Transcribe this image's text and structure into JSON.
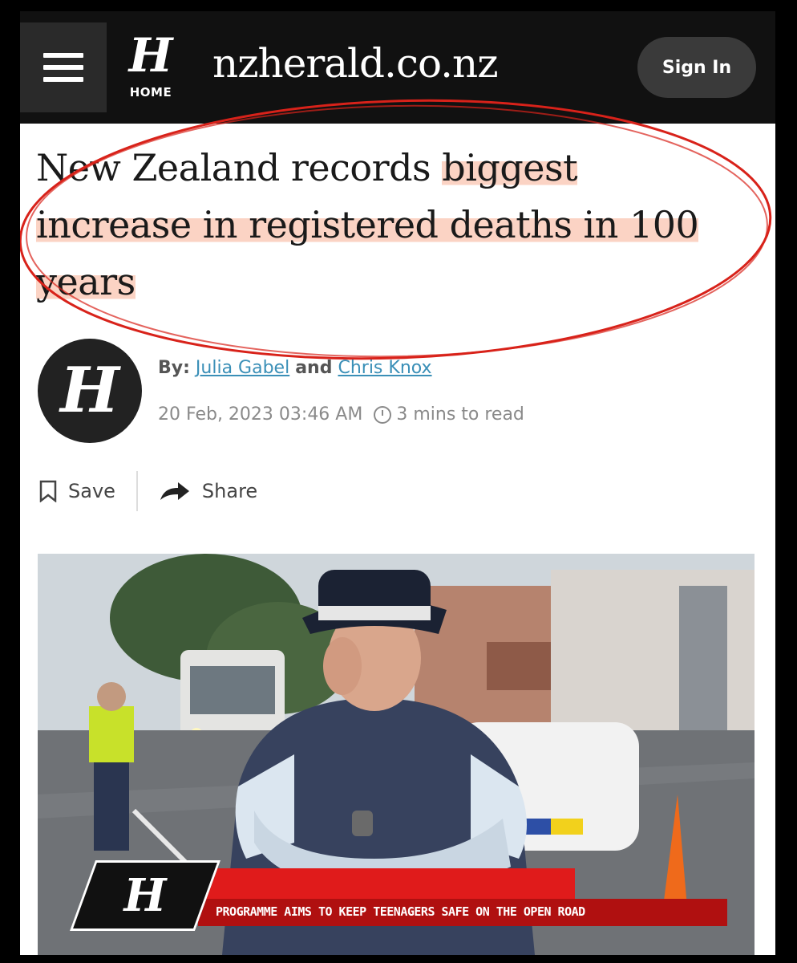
{
  "header": {
    "menu_icon": "hamburger-menu-icon",
    "logo_glyph": "H",
    "home_label": "HOME",
    "site_name": "nzherald.co.nz",
    "signin_label": "Sign In"
  },
  "article": {
    "headline_part1": "New Zealand records ",
    "headline_highlight1": "biggest",
    "headline_highlight2": "increase in registered deaths in 100",
    "headline_highlight3": "years",
    "byline_prefix": "By:",
    "author1": "Julia Gabel",
    "byline_and": "and",
    "author2": "Chris Knox",
    "avatar_glyph": "H",
    "date": "20 Feb, 2023 03:46 AM",
    "read_time": "3 mins to read",
    "save_label": "Save",
    "share_label": "Share"
  },
  "video": {
    "logo_glyph": "H",
    "tag": "",
    "caption": "PROGRAMME AIMS TO KEEP TEENAGERS SAFE ON THE OPEN ROAD"
  },
  "colors": {
    "highlight": "#fbd3c4",
    "annotation_circle": "#d8221a",
    "banner_red": "#e01b1b",
    "author_link": "#3a8fb7"
  }
}
